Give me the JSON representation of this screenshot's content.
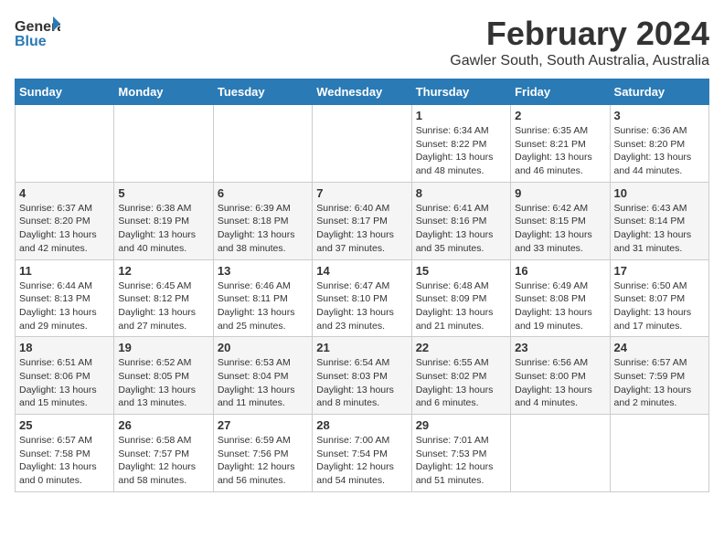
{
  "logo": {
    "general": "General",
    "blue": "Blue"
  },
  "title": "February 2024",
  "location": "Gawler South, South Australia, Australia",
  "headers": [
    "Sunday",
    "Monday",
    "Tuesday",
    "Wednesday",
    "Thursday",
    "Friday",
    "Saturday"
  ],
  "weeks": [
    [
      {
        "day": "",
        "sunrise": "",
        "sunset": "",
        "daylight": ""
      },
      {
        "day": "",
        "sunrise": "",
        "sunset": "",
        "daylight": ""
      },
      {
        "day": "",
        "sunrise": "",
        "sunset": "",
        "daylight": ""
      },
      {
        "day": "",
        "sunrise": "",
        "sunset": "",
        "daylight": ""
      },
      {
        "day": "1",
        "sunrise": "Sunrise: 6:34 AM",
        "sunset": "Sunset: 8:22 PM",
        "daylight": "Daylight: 13 hours and 48 minutes."
      },
      {
        "day": "2",
        "sunrise": "Sunrise: 6:35 AM",
        "sunset": "Sunset: 8:21 PM",
        "daylight": "Daylight: 13 hours and 46 minutes."
      },
      {
        "day": "3",
        "sunrise": "Sunrise: 6:36 AM",
        "sunset": "Sunset: 8:20 PM",
        "daylight": "Daylight: 13 hours and 44 minutes."
      }
    ],
    [
      {
        "day": "4",
        "sunrise": "Sunrise: 6:37 AM",
        "sunset": "Sunset: 8:20 PM",
        "daylight": "Daylight: 13 hours and 42 minutes."
      },
      {
        "day": "5",
        "sunrise": "Sunrise: 6:38 AM",
        "sunset": "Sunset: 8:19 PM",
        "daylight": "Daylight: 13 hours and 40 minutes."
      },
      {
        "day": "6",
        "sunrise": "Sunrise: 6:39 AM",
        "sunset": "Sunset: 8:18 PM",
        "daylight": "Daylight: 13 hours and 38 minutes."
      },
      {
        "day": "7",
        "sunrise": "Sunrise: 6:40 AM",
        "sunset": "Sunset: 8:17 PM",
        "daylight": "Daylight: 13 hours and 37 minutes."
      },
      {
        "day": "8",
        "sunrise": "Sunrise: 6:41 AM",
        "sunset": "Sunset: 8:16 PM",
        "daylight": "Daylight: 13 hours and 35 minutes."
      },
      {
        "day": "9",
        "sunrise": "Sunrise: 6:42 AM",
        "sunset": "Sunset: 8:15 PM",
        "daylight": "Daylight: 13 hours and 33 minutes."
      },
      {
        "day": "10",
        "sunrise": "Sunrise: 6:43 AM",
        "sunset": "Sunset: 8:14 PM",
        "daylight": "Daylight: 13 hours and 31 minutes."
      }
    ],
    [
      {
        "day": "11",
        "sunrise": "Sunrise: 6:44 AM",
        "sunset": "Sunset: 8:13 PM",
        "daylight": "Daylight: 13 hours and 29 minutes."
      },
      {
        "day": "12",
        "sunrise": "Sunrise: 6:45 AM",
        "sunset": "Sunset: 8:12 PM",
        "daylight": "Daylight: 13 hours and 27 minutes."
      },
      {
        "day": "13",
        "sunrise": "Sunrise: 6:46 AM",
        "sunset": "Sunset: 8:11 PM",
        "daylight": "Daylight: 13 hours and 25 minutes."
      },
      {
        "day": "14",
        "sunrise": "Sunrise: 6:47 AM",
        "sunset": "Sunset: 8:10 PM",
        "daylight": "Daylight: 13 hours and 23 minutes."
      },
      {
        "day": "15",
        "sunrise": "Sunrise: 6:48 AM",
        "sunset": "Sunset: 8:09 PM",
        "daylight": "Daylight: 13 hours and 21 minutes."
      },
      {
        "day": "16",
        "sunrise": "Sunrise: 6:49 AM",
        "sunset": "Sunset: 8:08 PM",
        "daylight": "Daylight: 13 hours and 19 minutes."
      },
      {
        "day": "17",
        "sunrise": "Sunrise: 6:50 AM",
        "sunset": "Sunset: 8:07 PM",
        "daylight": "Daylight: 13 hours and 17 minutes."
      }
    ],
    [
      {
        "day": "18",
        "sunrise": "Sunrise: 6:51 AM",
        "sunset": "Sunset: 8:06 PM",
        "daylight": "Daylight: 13 hours and 15 minutes."
      },
      {
        "day": "19",
        "sunrise": "Sunrise: 6:52 AM",
        "sunset": "Sunset: 8:05 PM",
        "daylight": "Daylight: 13 hours and 13 minutes."
      },
      {
        "day": "20",
        "sunrise": "Sunrise: 6:53 AM",
        "sunset": "Sunset: 8:04 PM",
        "daylight": "Daylight: 13 hours and 11 minutes."
      },
      {
        "day": "21",
        "sunrise": "Sunrise: 6:54 AM",
        "sunset": "Sunset: 8:03 PM",
        "daylight": "Daylight: 13 hours and 8 minutes."
      },
      {
        "day": "22",
        "sunrise": "Sunrise: 6:55 AM",
        "sunset": "Sunset: 8:02 PM",
        "daylight": "Daylight: 13 hours and 6 minutes."
      },
      {
        "day": "23",
        "sunrise": "Sunrise: 6:56 AM",
        "sunset": "Sunset: 8:00 PM",
        "daylight": "Daylight: 13 hours and 4 minutes."
      },
      {
        "day": "24",
        "sunrise": "Sunrise: 6:57 AM",
        "sunset": "Sunset: 7:59 PM",
        "daylight": "Daylight: 13 hours and 2 minutes."
      }
    ],
    [
      {
        "day": "25",
        "sunrise": "Sunrise: 6:57 AM",
        "sunset": "Sunset: 7:58 PM",
        "daylight": "Daylight: 13 hours and 0 minutes."
      },
      {
        "day": "26",
        "sunrise": "Sunrise: 6:58 AM",
        "sunset": "Sunset: 7:57 PM",
        "daylight": "Daylight: 12 hours and 58 minutes."
      },
      {
        "day": "27",
        "sunrise": "Sunrise: 6:59 AM",
        "sunset": "Sunset: 7:56 PM",
        "daylight": "Daylight: 12 hours and 56 minutes."
      },
      {
        "day": "28",
        "sunrise": "Sunrise: 7:00 AM",
        "sunset": "Sunset: 7:54 PM",
        "daylight": "Daylight: 12 hours and 54 minutes."
      },
      {
        "day": "29",
        "sunrise": "Sunrise: 7:01 AM",
        "sunset": "Sunset: 7:53 PM",
        "daylight": "Daylight: 12 hours and 51 minutes."
      },
      {
        "day": "",
        "sunrise": "",
        "sunset": "",
        "daylight": ""
      },
      {
        "day": "",
        "sunrise": "",
        "sunset": "",
        "daylight": ""
      }
    ]
  ]
}
